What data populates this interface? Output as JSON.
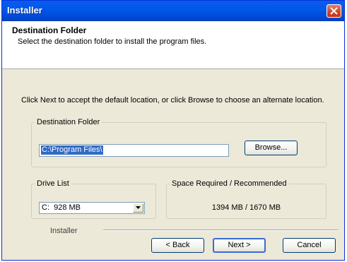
{
  "window": {
    "title": "Installer"
  },
  "header": {
    "title": "Destination Folder",
    "subtitle": "Select the destination folder to install the program files."
  },
  "instructions": "Click Next to accept the default location, or click Browse to choose an alternate location.",
  "destination": {
    "legend": "Destination Folder",
    "path": "C:\\Program Files\\",
    "browse_label": "Browse..."
  },
  "drive": {
    "legend": "Drive List",
    "selected": "C:  928 MB"
  },
  "space": {
    "legend": "Space Required / Recommended",
    "value": "1394 MB / 1670 MB"
  },
  "footer": {
    "label": "Installer",
    "back_label": "< Back",
    "next_label": "Next >",
    "cancel_label": "Cancel"
  },
  "colors": {
    "title_bar": "#0058e6",
    "close_button": "#d1442a",
    "face": "#ece9d8",
    "selection": "#316ac5"
  }
}
